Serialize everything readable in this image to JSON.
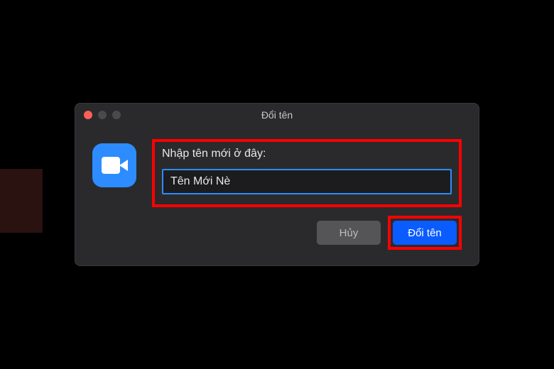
{
  "dialog": {
    "title": "Đổi tên",
    "label": "Nhập tên mới ở đây:",
    "input_value": "Tên Mới Nè",
    "cancel_label": "Hủy",
    "confirm_label": "Đổi tên"
  },
  "icons": {
    "app": "video-camera-icon"
  }
}
